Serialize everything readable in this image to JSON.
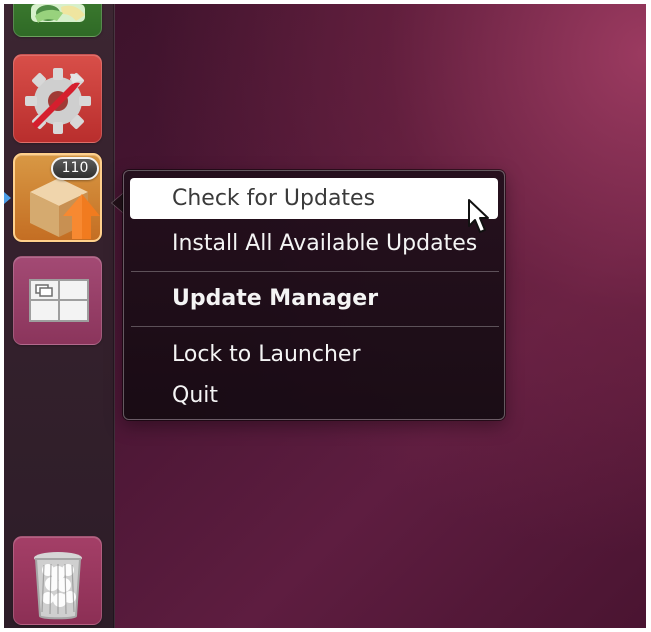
{
  "launcher": {
    "update_badge_count": "110"
  },
  "context_menu": {
    "items": [
      "Check for Updates",
      "Install All Available Updates",
      "Update Manager",
      "Lock to Launcher",
      "Quit"
    ]
  },
  "icons": {
    "top_app": "app-icon",
    "settings": "settings-icon",
    "updates": "update-manager-icon",
    "workspaces": "workspace-switcher-icon",
    "trash": "trash-icon",
    "cursor": "mouse-pointer-icon"
  },
  "colors": {
    "launcher_indicator": "#4c9ee8",
    "menu_highlight": "#ffffff",
    "menu_text": "#f4f4f4"
  }
}
